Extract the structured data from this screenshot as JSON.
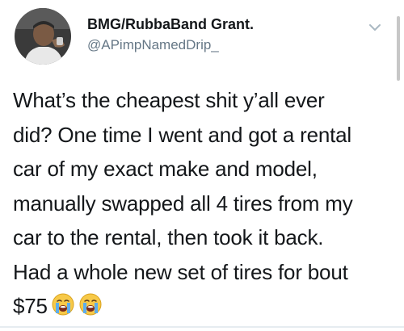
{
  "tweet": {
    "display_name": "BMG/RubbaBand Grant.",
    "handle": "@APimpNamedDrip_",
    "text_lines": [
      "What’s the cheapest shit y’all ever",
      "did? One time I went and got a rental",
      "car of my exact make and model,",
      "manually swapped all 4 tires from my",
      "car to the rental, then took it back.",
      "Had a whole new set of tires for bout",
      "$75"
    ],
    "emojis": [
      "loudly-crying-face-emoji",
      "loudly-crying-face-emoji"
    ],
    "menu_icon": "chevron-down-icon",
    "avatar": "avatar-photo"
  },
  "colors": {
    "text": "#14171a",
    "handle": "#657786",
    "chevron": "#aab8c2",
    "emoji_face": "#f7c948",
    "emoji_tears": "#5dadec"
  }
}
